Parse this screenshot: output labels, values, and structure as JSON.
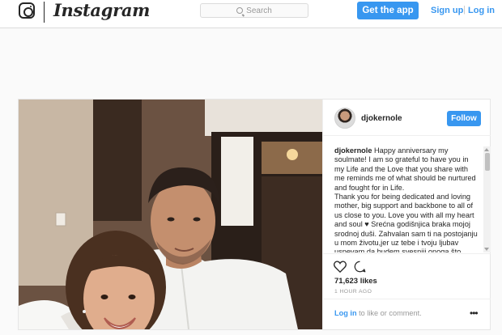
{
  "header": {
    "brand": "Instagram",
    "search_placeholder": "Search",
    "get_app_label": "Get the app",
    "signup_label": "Sign up",
    "separator": "|",
    "login_label": "Log in"
  },
  "post": {
    "username": "djokernole",
    "follow_label": "Follow",
    "caption_author": "djokernole",
    "caption_text": "Happy anniversary my soulmate! I am so grateful to have you in my Life and the Love that you share with me reminds me of what should be nurtured and fought for in Life.\nThank you for being dedicated and loving mother, big support and backbone to all of us close to you. Love you with all my heart and soul ♥ Srećna godišnjica braka mojoj srodnoj duši. Zahvalan sam ti na postojanju u mom životu,jer uz tebe i tvoju ljubav uspevam da budem svesniji onoga što",
    "likes": "71,623 likes",
    "time_ago": "1 HOUR AGO",
    "comment_login": "Log in",
    "comment_prompt": " to like or comment.",
    "more_options": "•••"
  },
  "icons": {
    "logo": "instagram-camera-icon",
    "search": "search-icon",
    "like": "heart-icon",
    "comment": "comment-icon",
    "more": "more-options-icon"
  },
  "colors": {
    "accent": "#3897f0",
    "text": "#262626",
    "muted": "#999999",
    "border": "#dbdbdb",
    "background": "#fafafa"
  }
}
